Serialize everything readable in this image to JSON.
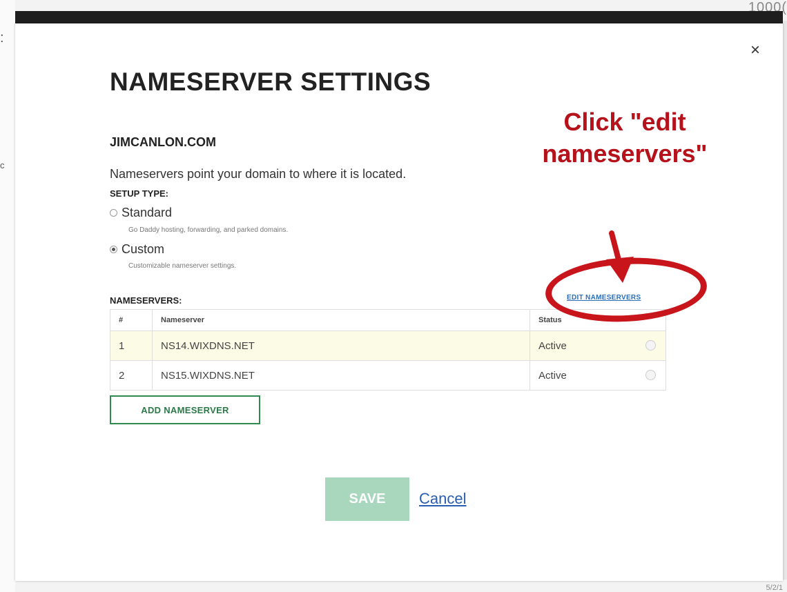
{
  "background": {
    "top_right_text": "1000(",
    "left_fragment_1": ":",
    "left_fragment_2": "c",
    "bottom_right_text": "5/2/1"
  },
  "modal": {
    "close_glyph": "×",
    "title": "NAMESERVER SETTINGS",
    "domain": "JIMCANLON.COM",
    "description": "Nameservers point your domain to where it is located.",
    "setup_type_label": "SETUP TYPE:",
    "options": [
      {
        "label": "Standard",
        "sub": "Go Daddy hosting, forwarding, and parked domains.",
        "checked": false
      },
      {
        "label": "Custom",
        "sub": "Customizable nameserver settings.",
        "checked": true
      }
    ],
    "nameservers_label": "NAMESERVERS:",
    "edit_link": "EDIT NAMESERVERS",
    "table": {
      "headers": [
        "#",
        "Nameserver",
        "Status"
      ],
      "rows": [
        {
          "num": "1",
          "name": "NS14.WIXDNS.NET",
          "status": "Active"
        },
        {
          "num": "2",
          "name": "NS15.WIXDNS.NET",
          "status": "Active"
        }
      ]
    },
    "add_button": "ADD NAMESERVER",
    "save_button": "SAVE",
    "cancel_link": "Cancel"
  },
  "annotation": {
    "callout_line1": "Click \"edit",
    "callout_line2": "nameservers\"",
    "color": "#c8141b"
  },
  "icons": [
    "close-icon",
    "radio-icon",
    "arrow-icon",
    "row-status-icon"
  ]
}
